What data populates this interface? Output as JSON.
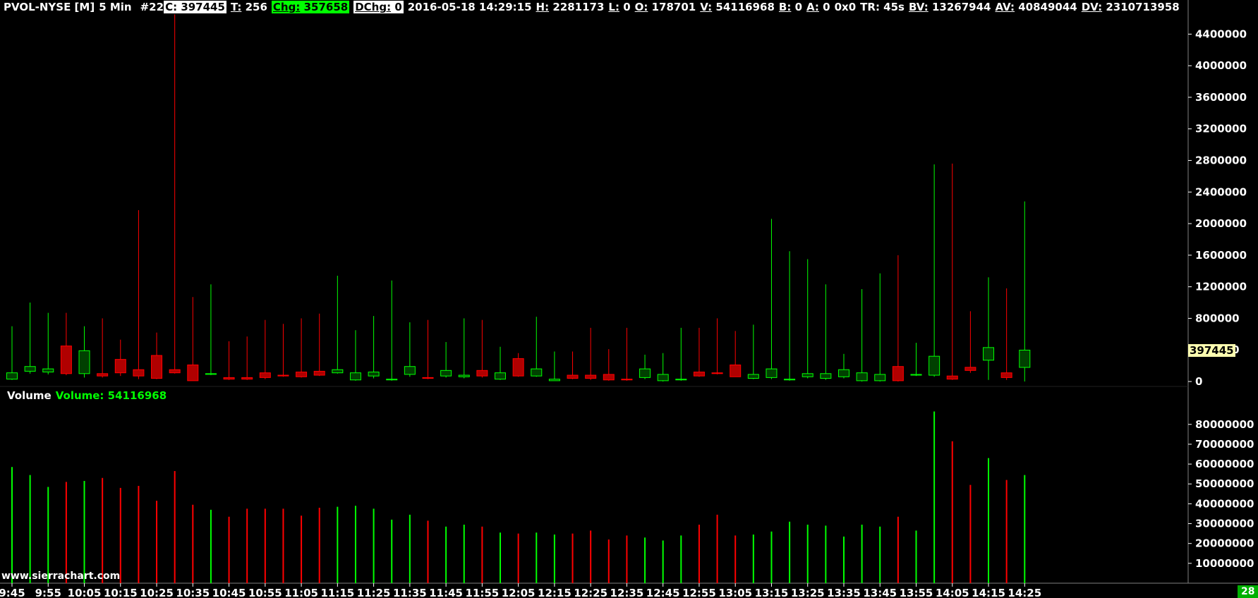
{
  "header": {
    "symbol": "PVOL-NYSE [M]",
    "timeframe": "5 Min",
    "bar_index": "#22",
    "close_label": "C:",
    "close_value": "397445",
    "trades_label": "T:",
    "trades_value": "256",
    "change_label": "Chg:",
    "change_value": "357658",
    "dchange_label": "DChg:",
    "dchange_value": "0",
    "datetime": "2016-05-18 14:29:15",
    "high_label": "H:",
    "high_value": "2281173",
    "low_label": "L:",
    "low_value": "0",
    "open_label": "O:",
    "open_value": "178701",
    "volume_label": "V:",
    "volume_value": "54116968",
    "bid_label": "B:",
    "bid_value": "0",
    "ask_label": "A:",
    "ask_value": "0",
    "spread": "0x0",
    "tr": "TR: 45s",
    "bv_label": "BV:",
    "bv_value": "13267944",
    "av_label": "AV:",
    "av_value": "40849044",
    "dv_label": "DV:",
    "dv_value": "2310713958"
  },
  "volume_header": {
    "title": "Volume",
    "value_text": "Volume: 54116968"
  },
  "watermark": "www.sierrachart.com",
  "last_price_label": "397445",
  "bar_count": "28",
  "colors": {
    "background": "#000000",
    "up": "#00ff00",
    "down": "#ff0000",
    "up_fill": "#004000",
    "down_fill": "#b00000",
    "axis_text": "#ffffff",
    "last_price_bg": "#ffffb0"
  },
  "chart_data": [
    {
      "type": "candlestick",
      "ylim": [
        0,
        4600000
      ],
      "yticks": [
        0,
        400000,
        800000,
        1200000,
        1600000,
        2000000,
        2400000,
        2800000,
        3200000,
        3600000,
        4000000,
        4400000
      ],
      "xticks": [
        "9:45",
        "9:55",
        "10:05",
        "10:15",
        "10:25",
        "10:35",
        "10:45",
        "10:55",
        "11:05",
        "11:15",
        "11:25",
        "11:35",
        "11:45",
        "11:55",
        "12:05",
        "12:15",
        "12:25",
        "12:35",
        "12:45",
        "12:55",
        "13:05",
        "13:15",
        "13:25",
        "13:35",
        "13:45",
        "13:55",
        "14:05",
        "14:15",
        "14:25"
      ],
      "bars": [
        {
          "o": 30000,
          "h": 700000,
          "l": 20000,
          "c": 110000
        },
        {
          "o": 130000,
          "h": 1000000,
          "l": 100000,
          "c": 190000
        },
        {
          "o": 120000,
          "h": 870000,
          "l": 90000,
          "c": 160000
        },
        {
          "o": 450000,
          "h": 870000,
          "l": 80000,
          "c": 100000
        },
        {
          "o": 100000,
          "h": 700000,
          "l": 50000,
          "c": 390000
        },
        {
          "o": 100000,
          "h": 800000,
          "l": 50000,
          "c": 70000
        },
        {
          "o": 280000,
          "h": 530000,
          "l": 70000,
          "c": 110000
        },
        {
          "o": 150000,
          "h": 2170000,
          "l": 30000,
          "c": 70000
        },
        {
          "o": 330000,
          "h": 620000,
          "l": 30000,
          "c": 40000
        },
        {
          "o": 150000,
          "h": 4650000,
          "l": 100000,
          "c": 110000
        },
        {
          "o": 210000,
          "h": 1070000,
          "l": 30000,
          "c": 10000
        },
        {
          "o": 90000,
          "h": 1230000,
          "l": 80000,
          "c": 100000
        },
        {
          "o": 50000,
          "h": 510000,
          "l": 20000,
          "c": 30000
        },
        {
          "o": 50000,
          "h": 570000,
          "l": 20000,
          "c": 30000
        },
        {
          "o": 110000,
          "h": 780000,
          "l": 30000,
          "c": 50000
        },
        {
          "o": 80000,
          "h": 730000,
          "l": 60000,
          "c": 70000
        },
        {
          "o": 120000,
          "h": 800000,
          "l": 50000,
          "c": 60000
        },
        {
          "o": 130000,
          "h": 860000,
          "l": 70000,
          "c": 80000
        },
        {
          "o": 110000,
          "h": 1340000,
          "l": 100000,
          "c": 150000
        },
        {
          "o": 20000,
          "h": 650000,
          "l": 10000,
          "c": 110000
        },
        {
          "o": 70000,
          "h": 830000,
          "l": 40000,
          "c": 120000
        },
        {
          "o": 20000,
          "h": 1280000,
          "l": 10000,
          "c": 30000
        },
        {
          "o": 90000,
          "h": 750000,
          "l": 60000,
          "c": 190000
        },
        {
          "o": 50000,
          "h": 780000,
          "l": 30000,
          "c": 40000
        },
        {
          "o": 70000,
          "h": 500000,
          "l": 50000,
          "c": 140000
        },
        {
          "o": 60000,
          "h": 800000,
          "l": 40000,
          "c": 80000
        },
        {
          "o": 140000,
          "h": 780000,
          "l": 50000,
          "c": 70000
        },
        {
          "o": 30000,
          "h": 440000,
          "l": 20000,
          "c": 110000
        },
        {
          "o": 290000,
          "h": 360000,
          "l": 60000,
          "c": 70000
        },
        {
          "o": 70000,
          "h": 820000,
          "l": 60000,
          "c": 160000
        },
        {
          "o": 10000,
          "h": 380000,
          "l": 10000,
          "c": 30000
        },
        {
          "o": 80000,
          "h": 380000,
          "l": 30000,
          "c": 40000
        },
        {
          "o": 80000,
          "h": 680000,
          "l": 20000,
          "c": 40000
        },
        {
          "o": 90000,
          "h": 410000,
          "l": 10000,
          "c": 20000
        },
        {
          "o": 30000,
          "h": 680000,
          "l": 10000,
          "c": 20000
        },
        {
          "o": 50000,
          "h": 340000,
          "l": 30000,
          "c": 160000
        },
        {
          "o": 10000,
          "h": 360000,
          "l": 0,
          "c": 90000
        },
        {
          "o": 20000,
          "h": 680000,
          "l": 10000,
          "c": 30000
        },
        {
          "o": 120000,
          "h": 680000,
          "l": 60000,
          "c": 70000
        },
        {
          "o": 110000,
          "h": 800000,
          "l": 90000,
          "c": 100000
        },
        {
          "o": 210000,
          "h": 640000,
          "l": 60000,
          "c": 60000
        },
        {
          "o": 40000,
          "h": 720000,
          "l": 30000,
          "c": 90000
        },
        {
          "o": 50000,
          "h": 2060000,
          "l": 30000,
          "c": 160000
        },
        {
          "o": 20000,
          "h": 1650000,
          "l": 10000,
          "c": 30000
        },
        {
          "o": 60000,
          "h": 1550000,
          "l": 40000,
          "c": 100000
        },
        {
          "o": 40000,
          "h": 1230000,
          "l": 20000,
          "c": 100000
        },
        {
          "o": 60000,
          "h": 350000,
          "l": 40000,
          "c": 150000
        },
        {
          "o": 10000,
          "h": 1170000,
          "l": 0,
          "c": 110000
        },
        {
          "o": 10000,
          "h": 1370000,
          "l": 0,
          "c": 90000
        },
        {
          "o": 190000,
          "h": 1600000,
          "l": 0,
          "c": 10000
        },
        {
          "o": 80000,
          "h": 490000,
          "l": 70000,
          "c": 90000
        },
        {
          "o": 80000,
          "h": 2750000,
          "l": 60000,
          "c": 320000
        },
        {
          "o": 70000,
          "h": 2760000,
          "l": 20000,
          "c": 30000
        },
        {
          "o": 180000,
          "h": 890000,
          "l": 110000,
          "c": 140000
        },
        {
          "o": 270000,
          "h": 1320000,
          "l": 20000,
          "c": 430000
        },
        {
          "o": 110000,
          "h": 1180000,
          "l": 20000,
          "c": 50000
        },
        {
          "o": 178701,
          "h": 2281173,
          "l": 0,
          "c": 397445
        }
      ]
    },
    {
      "type": "bar",
      "name": "Volume",
      "ylim": [
        0,
        92000000
      ],
      "yticks": [
        10000000,
        20000000,
        30000000,
        40000000,
        50000000,
        60000000,
        70000000,
        80000000
      ],
      "values": [
        58500000,
        54500000,
        48500000,
        51000000,
        51500000,
        53000000,
        48000000,
        49000000,
        41500000,
        56500000,
        39500000,
        37000000,
        33500000,
        37500000,
        37500000,
        37500000,
        34000000,
        38000000,
        38500000,
        39000000,
        37500000,
        32000000,
        34500000,
        31500000,
        28500000,
        29500000,
        28500000,
        25500000,
        25000000,
        25500000,
        24500000,
        25000000,
        26500000,
        22000000,
        24000000,
        23000000,
        21500000,
        24000000,
        29500000,
        34500000,
        24000000,
        24500000,
        26000000,
        31000000,
        29500000,
        29000000,
        23500000,
        29500000,
        28500000,
        33500000,
        26500000,
        86500000,
        71500000,
        49500000,
        63000000,
        52000000,
        54500000
      ],
      "up": [
        true,
        true,
        true,
        false,
        true,
        false,
        false,
        false,
        false,
        false,
        false,
        true,
        false,
        false,
        false,
        false,
        false,
        false,
        true,
        true,
        true,
        true,
        true,
        false,
        true,
        true,
        false,
        true,
        false,
        true,
        true,
        false,
        false,
        false,
        false,
        true,
        true,
        true,
        false,
        false,
        false,
        true,
        true,
        true,
        true,
        true,
        true,
        true,
        true,
        false,
        true,
        true,
        false,
        false,
        true,
        false,
        true
      ]
    }
  ]
}
